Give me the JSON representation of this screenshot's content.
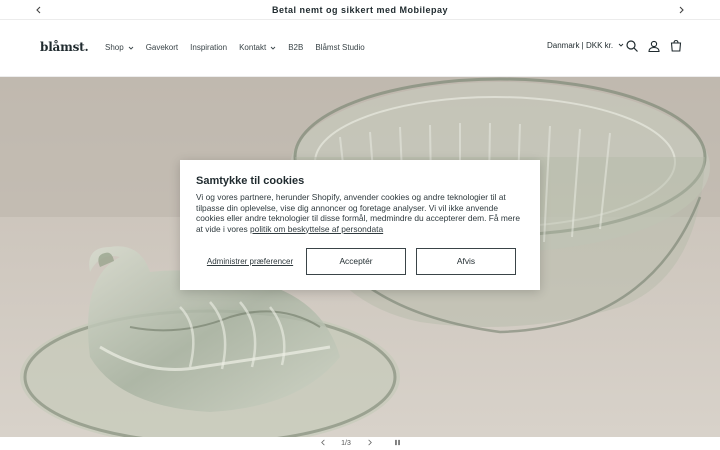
{
  "announcement": {
    "text": "Betal nemt og sikkert med Mobilepay",
    "prev_icon": "chevron-left-icon",
    "next_icon": "chevron-right-icon"
  },
  "header": {
    "logo": "blåmst.",
    "nav": [
      {
        "label": "Shop",
        "has_dropdown": true
      },
      {
        "label": "Gavekort",
        "has_dropdown": false
      },
      {
        "label": "Inspiration",
        "has_dropdown": false
      },
      {
        "label": "Kontakt",
        "has_dropdown": true
      },
      {
        "label": "B2B",
        "has_dropdown": false
      },
      {
        "label": "Blåmst Studio",
        "has_dropdown": false
      }
    ],
    "locale": "Danmark | DKK kr.",
    "icons": [
      "search-icon",
      "account-icon",
      "cart-icon"
    ]
  },
  "cookie_banner": {
    "title": "Samtykke til cookies",
    "body": "Vi og vores partnere, herunder Shopify, anvender cookies og andre teknologier til at tilpasse din oplevelse, vise dig annoncer og foretage analyser. Vi vil ikke anvende cookies eller andre teknologier til disse formål, medmindre du accepterer dem. Få mere at vide i vores ",
    "link": "politik om beskyttelse af persondata",
    "manage_label": "Administrer præferencer",
    "accept_label": "Acceptér",
    "decline_label": "Afvis"
  },
  "slider": {
    "counter": "1/3",
    "prev_icon": "chevron-left-icon",
    "next_icon": "chevron-right-icon",
    "pause_icon": "pause-icon"
  },
  "colors": {
    "text": "#1f2a2e",
    "border": "#3a4448",
    "hero_bg": "#c4bdb3"
  }
}
